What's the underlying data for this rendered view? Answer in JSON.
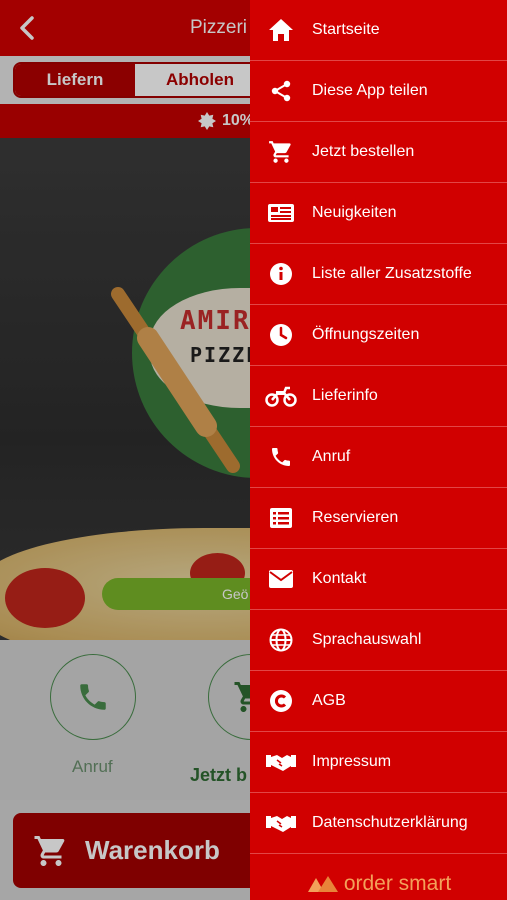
{
  "header": {
    "title": "Pizzeri",
    "back_icon": "chevron-left-icon"
  },
  "tabs": [
    {
      "label": "Liefern",
      "active": true
    },
    {
      "label": "Abholen",
      "active": false
    }
  ],
  "promo": {
    "text": "10%",
    "icon": "badge-icon"
  },
  "hero": {
    "logo_line1": "AMIR",
    "logo_line2": "PIZZE",
    "status_button": "Geö"
  },
  "actions": [
    {
      "label": "Anruf",
      "icon": "phone-icon"
    },
    {
      "label": "Jetzt b",
      "icon": "cart-icon"
    }
  ],
  "cart_button": {
    "label": "Warenkorb",
    "icon": "cart-icon"
  },
  "menu": [
    {
      "label": "Startseite",
      "icon": "home-icon"
    },
    {
      "label": "Diese App teilen",
      "icon": "share-icon"
    },
    {
      "label": "Jetzt bestellen",
      "icon": "cart-icon"
    },
    {
      "label": "Neuigkeiten",
      "icon": "news-icon"
    },
    {
      "label": "Liste aller Zusatzstoffe",
      "icon": "info-icon"
    },
    {
      "label": "Öffnungszeiten",
      "icon": "clock-icon"
    },
    {
      "label": "Lieferinfo",
      "icon": "motorbike-icon"
    },
    {
      "label": "Anruf",
      "icon": "phone-icon"
    },
    {
      "label": "Reservieren",
      "icon": "list-icon"
    },
    {
      "label": "Kontakt",
      "icon": "mail-icon"
    },
    {
      "label": "Sprachauswahl",
      "icon": "globe-icon"
    },
    {
      "label": "AGB",
      "icon": "copyright-icon"
    },
    {
      "label": "Impressum",
      "icon": "handshake-icon"
    },
    {
      "label": "Datenschutzerklärung",
      "icon": "handshake-icon"
    }
  ],
  "brand": {
    "text": "order smart",
    "icon": "order-smart-logo-icon"
  },
  "colors": {
    "primary": "#d10000",
    "dark": "#a30000",
    "green": "#4a8b4e",
    "brand": "#f3a15a"
  }
}
